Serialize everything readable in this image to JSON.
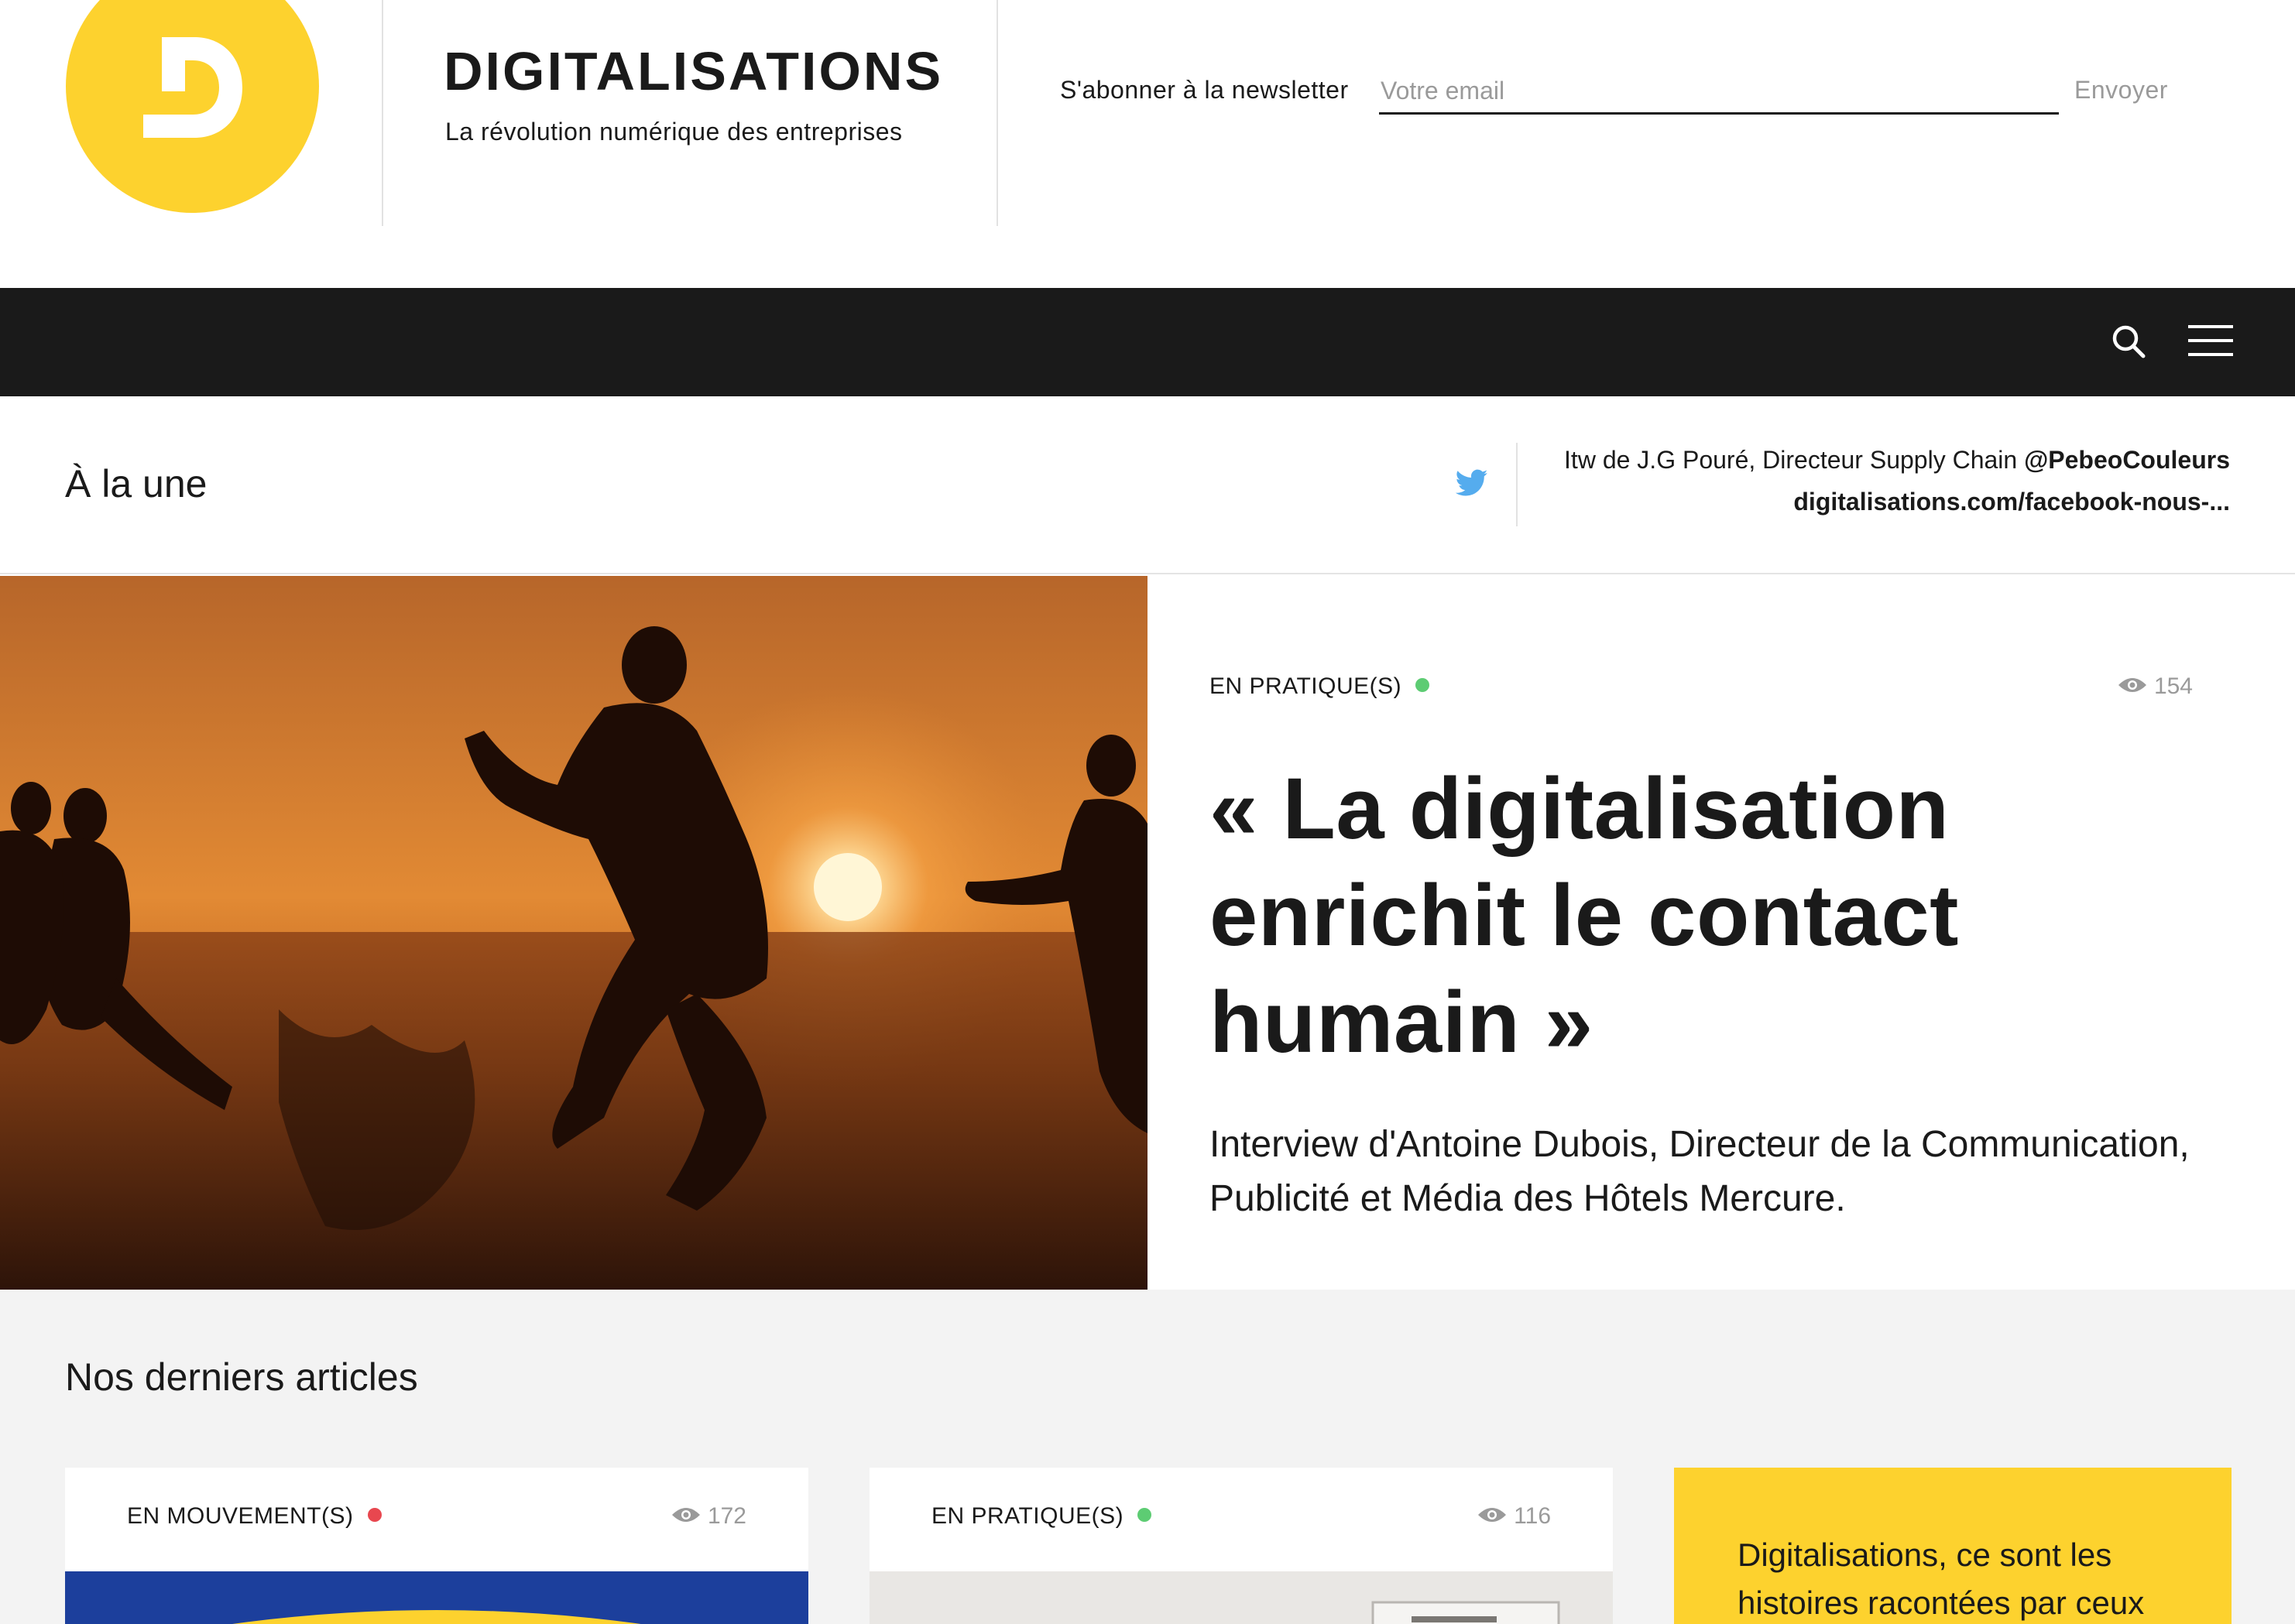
{
  "header": {
    "logo_letter": "D",
    "brand_title": "DIGITALISATIONS",
    "brand_subtitle": "La révolution numérique des entreprises",
    "newsletter_label": "S'abonner à la newsletter",
    "email_placeholder": "Votre email",
    "email_value": "",
    "send_label": "Envoyer"
  },
  "nav": {
    "icons": [
      "search-icon",
      "menu-icon"
    ]
  },
  "une": {
    "title": "À la une",
    "tweet_text": "Itw de J.G Pouré, Directeur Supply Chain ",
    "tweet_handle": "@PebeoCouleurs",
    "tweet_link": "digitalisations.com/facebook-nous-..."
  },
  "featured": {
    "category": "EN PRATIQUE(S)",
    "category_color": "#5dcc73",
    "views": "154",
    "title": "« La digitalisation enrichit le contact humain »",
    "description": "Interview d'Antoine Dubois, Directeur de la Communication, Publicité et Média des Hôtels Mercure."
  },
  "latest": {
    "title": "Nos derniers articles",
    "cards": [
      {
        "category": "EN MOUVEMENT(S)",
        "category_color": "#e8474f",
        "views": "172"
      },
      {
        "category": "EN PRATIQUE(S)",
        "category_color": "#5dcc73",
        "views": "116"
      }
    ],
    "promo_text": "Digitalisations, ce sont les histoires racontées par ceux"
  },
  "colors": {
    "accent_yellow": "#fdd22e",
    "navbar_bg": "#1a1a1a",
    "twitter_blue": "#55acee",
    "muted_text": "#9a9a9a"
  }
}
